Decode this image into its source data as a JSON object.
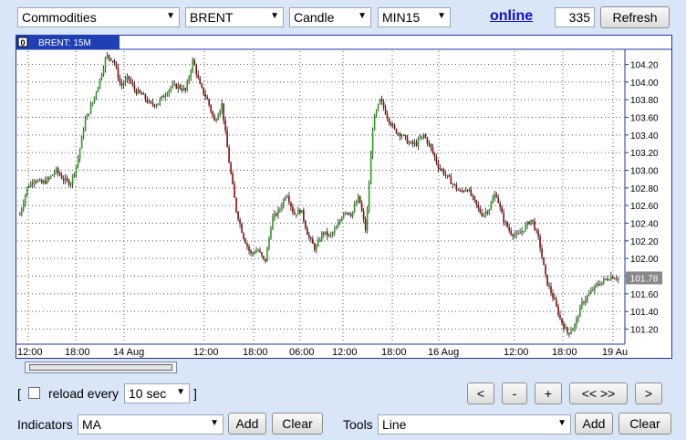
{
  "toolbar": {
    "category": "Commodities",
    "symbol": "BRENT",
    "chart_type": "Candle",
    "timeframe": "MIN15",
    "status_link": "online",
    "bar_count": "335",
    "refresh_label": "Refresh"
  },
  "chart": {
    "tab_index": "0",
    "tab_label": "BRENT: 15M",
    "current_price_label": "101.78",
    "colors": {
      "up": "#2c9a1e",
      "down": "#8b0a0a",
      "frame": "#2233aa",
      "tab": "#1f3fb5"
    }
  },
  "chart_data": {
    "type": "candlestick",
    "title": "BRENT: 15M",
    "y_ticks": [
      "104.20",
      "104.00",
      "103.80",
      "103.60",
      "103.40",
      "103.20",
      "103.00",
      "102.80",
      "102.60",
      "102.40",
      "102.20",
      "102.00",
      "101.80",
      "101.60",
      "101.40",
      "101.20"
    ],
    "x_ticks": [
      "12:00",
      "18:00",
      "14 Aug",
      "12:00",
      "18:00",
      "06:00",
      "12:00",
      "18:00",
      "16 Aug",
      "12:00",
      "18:00",
      "19 Au"
    ],
    "ylim": [
      101.0,
      104.35
    ],
    "last_price": 101.78,
    "close_path": [
      102.5,
      102.8,
      102.9,
      102.85,
      102.9,
      103.0,
      102.9,
      102.85,
      103.1,
      103.55,
      103.75,
      104.0,
      104.3,
      104.25,
      103.95,
      104.05,
      103.9,
      103.85,
      103.75,
      103.75,
      103.85,
      103.95,
      103.95,
      103.9,
      104.25,
      103.95,
      103.8,
      103.55,
      103.75,
      103.1,
      102.55,
      102.25,
      102.05,
      102.1,
      101.95,
      102.45,
      102.55,
      102.75,
      102.5,
      102.55,
      102.25,
      102.1,
      102.3,
      102.25,
      102.35,
      102.55,
      102.5,
      102.7,
      102.3,
      103.55,
      103.8,
      103.6,
      103.45,
      103.4,
      103.3,
      103.3,
      103.4,
      103.25,
      103.05,
      102.95,
      102.85,
      102.75,
      102.8,
      102.65,
      102.5,
      102.55,
      102.75,
      102.45,
      102.3,
      102.25,
      102.35,
      102.45,
      102.2,
      101.75,
      101.55,
      101.3,
      101.15,
      101.25,
      101.5,
      101.6,
      101.7,
      101.75,
      101.8,
      101.78
    ]
  },
  "scroll": {
    "label": "horizontal-scrollbar"
  },
  "controls": {
    "bracket_open": "[",
    "reload_label": "reload every",
    "reload_interval": "10 sec",
    "bracket_close": "]",
    "nav": {
      "prev": "<",
      "minus": "-",
      "plus": "+",
      "expand": "<< >>",
      "next": ">"
    }
  },
  "bottom": {
    "indicators_label": "Indicators",
    "indicator_value": "MA",
    "tools_label": "Tools",
    "tool_value": "Line",
    "add_label": "Add",
    "clear_label": "Clear"
  }
}
